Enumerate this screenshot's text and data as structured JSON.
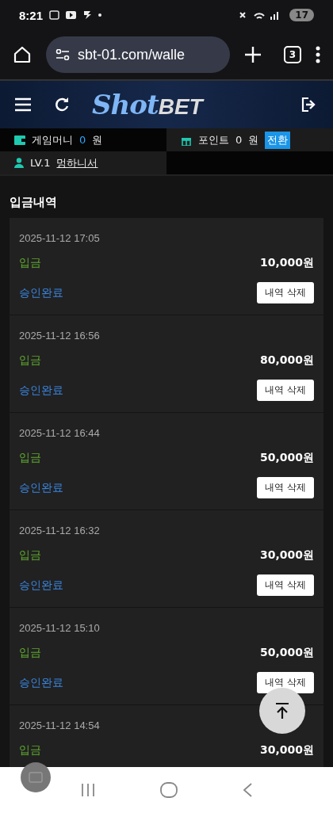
{
  "status_bar": {
    "time": "8:21",
    "battery": "17"
  },
  "browser": {
    "url": "sbt-01.com/walle",
    "tab_count": "3"
  },
  "header": {
    "logo_script": "Shot",
    "logo_bold": "BET"
  },
  "account": {
    "money_label": "게임머니",
    "money_value": "0",
    "money_unit": "원",
    "point_label": "포인트",
    "point_value": "0",
    "point_unit": "원",
    "convert_button": "전환",
    "level": "LV.1",
    "username": "멍하니서"
  },
  "section_title": "입금내역",
  "entries": [
    {
      "date": "2025-11-12 17:05",
      "type": "입금",
      "amount": "10,000원",
      "status": "승인완료",
      "button": "내역 삭제"
    },
    {
      "date": "2025-11-12 16:56",
      "type": "입금",
      "amount": "80,000원",
      "status": "승인완료",
      "button": "내역 삭제"
    },
    {
      "date": "2025-11-12 16:44",
      "type": "입금",
      "amount": "50,000원",
      "status": "승인완료",
      "button": "내역 삭제"
    },
    {
      "date": "2025-11-12 16:32",
      "type": "입금",
      "amount": "30,000원",
      "status": "승인완료",
      "button": "내역 삭제"
    },
    {
      "date": "2025-11-12 15:10",
      "type": "입금",
      "amount": "50,000원",
      "status": "승인완료",
      "button": "내역 삭제"
    },
    {
      "date": "2025-11-12 14:54",
      "type": "입금",
      "amount": "30,000원"
    }
  ]
}
